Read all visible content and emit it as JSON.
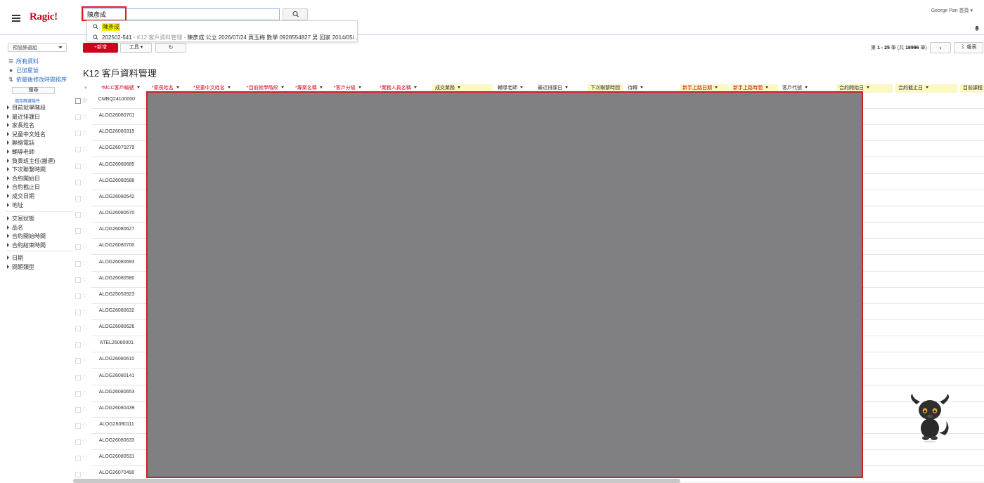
{
  "topbar": {
    "logo": "Ragic!",
    "search_value": "陳彥成",
    "user": "George Pan 首頁 ▾"
  },
  "search_dropdown": {
    "keyword": "陳彥成",
    "result_id": "202502-541",
    "result_sheet": " - K12 客戶資料管理 - ",
    "result_text": "陳彥成 公立 2026/07/24 黃玉梅 數學 0928554827 男 回家 2014/05/..."
  },
  "sidebar": {
    "default_set": "預設篩選組",
    "links": [
      "所有資料",
      "已加星號",
      "依最後修改時間排序"
    ],
    "search_button": "搜尋",
    "save_condition": "儲存篩選條件",
    "filters_group1": [
      "目前就學階段",
      "最近排課日",
      "家長姓名",
      "兒童中文姓名",
      "聯絡電話",
      "輔導老師",
      "負責班主任(搬運)",
      "下次聯繫時間",
      "合約開始日",
      "合約截止日",
      "成交日期",
      "地址"
    ],
    "filters_group2": [
      "交易狀態",
      "品名",
      "合約開始時間",
      "合約結束時間"
    ],
    "filters_group3": [
      "日期",
      "問題類型"
    ]
  },
  "toolbar": {
    "new_label": "+新增",
    "tool_label": "工具",
    "refresh_icon": "↻",
    "pager_prefix": "第 ",
    "pager_range": "1 - 25",
    "pager_mid": " 筆 (共 ",
    "pager_total": "18996",
    "pager_suffix": " 筆)",
    "next_icon": "›",
    "report_label": "報表"
  },
  "page_title": "K12 客戶資料管理",
  "columns": [
    {
      "label": "*MCC客戶編號",
      "required": true,
      "yellow": false
    },
    {
      "label": "*家長姓名",
      "required": true,
      "yellow": false
    },
    {
      "label": "*兒童中文姓名",
      "required": true,
      "yellow": false
    },
    {
      "label": "*目前就學階段",
      "required": true,
      "yellow": false
    },
    {
      "label": "*專案名稱",
      "required": true,
      "yellow": false
    },
    {
      "label": "*客戶分級",
      "required": true,
      "yellow": false
    },
    {
      "label": "*業務人員名稱",
      "required": true,
      "yellow": false
    },
    {
      "label": "成交業務",
      "required": false,
      "yellow": true
    },
    {
      "label": "輔導老師",
      "required": false,
      "yellow": false
    },
    {
      "label": "最近排課日",
      "required": false,
      "yellow": false
    },
    {
      "label": "下次聯繫時間",
      "required": false,
      "yellow": true
    },
    {
      "label": "待轉",
      "required": false,
      "yellow": false
    },
    {
      "label": "新手上路日期",
      "required": true,
      "yellow": true
    },
    {
      "label": "新手上路時間",
      "required": true,
      "yellow": true
    },
    {
      "label": "客戶代號",
      "required": false,
      "yellow": false
    },
    {
      "label": "合約開始日",
      "required": false,
      "yellow": true
    },
    {
      "label": "合約截止日",
      "required": false,
      "yellow": true
    },
    {
      "label": "目前課程",
      "required": false,
      "yellow": true
    }
  ],
  "rows": [
    "CMBQ24100000",
    "ALOG26080701",
    "ALOG26080315",
    "ALOG26070279",
    "ALOG26080685",
    "ALOG26080588",
    "ALOG26080542",
    "ALOG26080670",
    "ALOG26080627",
    "ALOG26080700",
    "ALOG26080693",
    "ALOG26080580",
    "ALOG25050923",
    "ALOG26080632",
    "ALOG26080626",
    "ATEL26080001",
    "ALOG26080610",
    "ALOG26080141",
    "ALOG26080653",
    "ALOG26080439",
    "ALOG26080111",
    "ALOG26080633",
    "ALOG26080531",
    "ALOG26070490"
  ],
  "colors": {
    "brand": "#d0021b",
    "highlight": "#d21f26",
    "redaction": "#808083"
  }
}
